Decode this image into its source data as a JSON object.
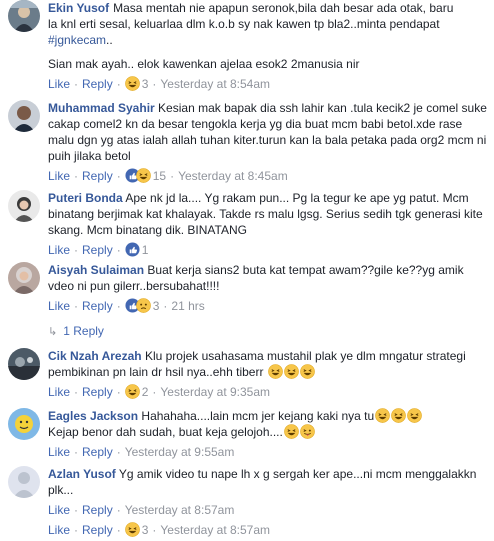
{
  "comments": [
    {
      "author": "Ekin Yusof",
      "line1": "Masa mentah nie apapun seronok,bila dah besar ada otak, baru",
      "line2": "la knl erti sesal, keluarlaa dlm k.o.b sy nak kawen tp bla2..minta pendapat",
      "hashtag": "#jgnkecam",
      "hashtag_tail": "..",
      "line4": "Sian mak ayah.. elok kawenkan ajelaa esok2 2manusia nir",
      "like": "Like",
      "reply": "Reply",
      "reaction_count": "3",
      "time": "Yesterday at 8:54am"
    },
    {
      "author": "Muhammad Syahir",
      "text": "Kesian mak bapak dia ssh lahir kan .tula kecik2 je comel suke cakap comel2 kn da besar tengokla kerja yg dia buat mcm babi betol.xde rase malu dgn yg atas ialah allah tuhan kiter.turun kan la bala petaka pada org2 mcm ni puih jilaka betol",
      "like": "Like",
      "reply": "Reply",
      "reaction_count": "15",
      "time": "Yesterday at 8:45am"
    },
    {
      "author": "Puteri Bonda",
      "text": "Ape nk jd la.... Yg rakam pun... Pg la tegur ke ape yg patut. Mcm binatang berjimak kat khalayak. Takde rs malu lgsg. Serius sedih tgk generasi kite skang. Mcm binatang dik. BINATANG",
      "like": "Like",
      "reply": "Reply",
      "reaction_count": "1"
    },
    {
      "author": "Aisyah Sulaiman",
      "text": "Buat kerja sians2 buta kat tempat awam??gile ke??yg amik vdeo ni pun gilerr..bersubahat!!!!",
      "like": "Like",
      "reply": "Reply",
      "reaction_count": "3",
      "time": "21 hrs",
      "replies_label": "1 Reply"
    },
    {
      "author": "Cik Nzah Arezah",
      "text": "Klu projek usahasama mustahil plak ye dlm mngatur strategi pembikinan pn lain dr hsil nya..ehh tiberr",
      "like": "Like",
      "reply": "Reply",
      "reaction_count": "2",
      "time": "Yesterday at 9:35am"
    },
    {
      "author": "Eagles Jackson",
      "text": "Hahahaha....lain mcm jer kejang kaki nya tu",
      "line2": "Kejap benor dah sudah, buat keja gelojoh....",
      "like": "Like",
      "reply": "Reply",
      "time": "Yesterday at 9:55am"
    },
    {
      "author": "Azlan Yusof",
      "text": "Yg amik video tu nape lh x g sergah ker ape...ni mcm menggalakkn plk...",
      "like": "Like",
      "reply": "Reply",
      "time": "Yesterday at 8:57am"
    },
    {
      "partial_like": "Like",
      "partial_reply": "Reply",
      "partial_count": "3",
      "partial_time": "Yesterday at 8:57am"
    }
  ],
  "colors": {
    "link": "#4267b2",
    "author": "#365899",
    "meta": "#90949c",
    "text": "#1d2129"
  },
  "icons": [
    "haha-reaction-icon",
    "like-reaction-icon",
    "reply-arrow-icon",
    "laughing-emoji-icon",
    "tongue-emoji-icon"
  ]
}
